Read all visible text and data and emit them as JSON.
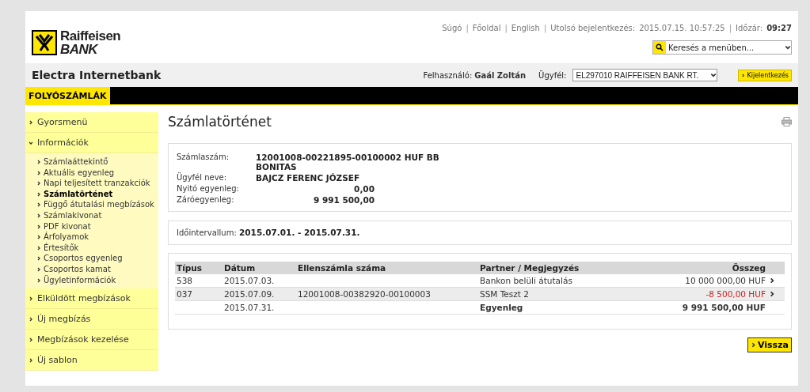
{
  "brand": {
    "name": "Raiffeisen",
    "sub": "BANK"
  },
  "top_links": [
    "Súgó",
    "Főoldal",
    "English"
  ],
  "separator": "|",
  "last_login": {
    "label": "Utolsó bejelentkezés:",
    "value": "2015.07.15. 10:57:25"
  },
  "session": {
    "label": "Időzár:",
    "value": "09:27"
  },
  "menu_search": {
    "placeholder": "Keresés a menüben..."
  },
  "app_title": "Electra Internetbank",
  "user": {
    "label": "Felhasználó:",
    "value": "Gaál Zoltán"
  },
  "client": {
    "label": "Ügyfél:",
    "value": "EL297010 RAIFFEISEN BANK RT."
  },
  "logout_button": "Kijelentkezés",
  "nav_tabs": [
    {
      "label": "FOLYÓSZÁMLÁK",
      "selected": true
    }
  ],
  "sidebar": {
    "items": [
      {
        "label": "Gyorsmenü",
        "expanded": false
      },
      {
        "label": "Információk",
        "expanded": true,
        "children": [
          {
            "label": "Számlaáttekintő",
            "selected": false
          },
          {
            "label": "Aktuális egyenleg",
            "selected": false
          },
          {
            "label": "Napi teljesített tranzakciók",
            "selected": false
          },
          {
            "label": "Számlatörténet",
            "selected": true
          },
          {
            "label": "Függő átutalási megbízások",
            "selected": false
          },
          {
            "label": "Számlakivonat",
            "selected": false
          },
          {
            "label": "PDF kivonat",
            "selected": false
          },
          {
            "label": "Árfolyamok",
            "selected": false
          },
          {
            "label": "Értesítők",
            "selected": false
          },
          {
            "label": "Csoportos egyenleg",
            "selected": false
          },
          {
            "label": "Csoportos kamat",
            "selected": false
          },
          {
            "label": "Ügyletinformációk",
            "selected": false
          }
        ]
      },
      {
        "label": "Elküldött megbízások",
        "expanded": false
      },
      {
        "label": "Új megbízás",
        "expanded": false
      },
      {
        "label": "Megbízások kezelése",
        "expanded": false
      },
      {
        "label": "Új sablon",
        "expanded": false
      }
    ]
  },
  "page_title": "Számlatörténet",
  "account": [
    {
      "label": "Számlaszám:",
      "value": "12001008-00221895-00100002 HUF BB BONITAS",
      "kind": "text"
    },
    {
      "label": "Ügyfél neve:",
      "value": "BAJCZ FERENC JÓZSEF",
      "kind": "text"
    },
    {
      "label": "Nyitó egyenleg:",
      "value": "0,00",
      "kind": "amount"
    },
    {
      "label": "Záróegyenleg:",
      "value": "9 991 500,00",
      "kind": "amount"
    }
  ],
  "interval": {
    "label": "Időintervallum:",
    "value": "2015.07.01. - 2015.07.31."
  },
  "table": {
    "columns": [
      "Típus",
      "Dátum",
      "Ellenszámla száma",
      "Partner / Megjegyzés",
      "Összeg"
    ],
    "rows": [
      {
        "kind": "transaction",
        "cells": [
          "538",
          "2015.07.03.",
          "",
          "Bankon belüli átutalás",
          "10 000 000,00 HUF"
        ],
        "negative": false
      },
      {
        "kind": "transaction",
        "cells": [
          "037",
          "2015.07.09.",
          "12001008-00382920-00100003",
          "SSM Teszt 2",
          "-8 500,00 HUF"
        ],
        "negative": true
      },
      {
        "kind": "balance",
        "cells": [
          "",
          "2015.07.31.",
          "",
          "Egyenleg",
          "9 991 500,00 HUF"
        ],
        "negative": false
      }
    ]
  },
  "back_button": "Vissza"
}
